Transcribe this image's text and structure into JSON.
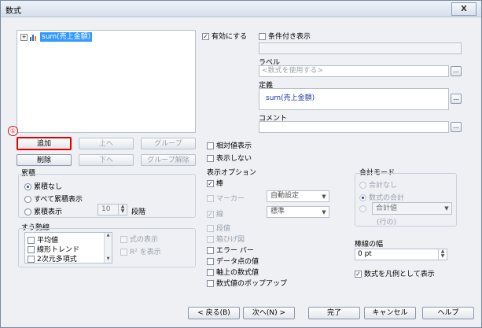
{
  "title": "数式",
  "close_label": "X",
  "tree": {
    "expander": "+",
    "item_label": "sum(売上金額)"
  },
  "badge": "①",
  "buttons": {
    "add": "追加",
    "up": "上へ",
    "group": "グループ",
    "delete": "削除",
    "down": "下へ",
    "ungroup": "グループ解除"
  },
  "enable": {
    "label": "有効にする",
    "checked": true
  },
  "conditional": {
    "label": "条件付き表示",
    "checked": false
  },
  "label_section": {
    "title": "ラベル",
    "placeholder": "<数式を使用する>"
  },
  "definition": {
    "title": "定義",
    "value": "sum(売上金額)"
  },
  "comment": {
    "title": "コメント",
    "value": ""
  },
  "ellipsis": "...",
  "relative": {
    "label": "相対値表示",
    "checked": false
  },
  "hidden": {
    "label": "表示しない",
    "checked": false
  },
  "accumulation": {
    "title": "累積",
    "options": [
      "累積なし",
      "すべて累積表示",
      "累積表示"
    ],
    "selected": 0,
    "steps_value": "10",
    "steps_label": "段階"
  },
  "trendline": {
    "title": "すう勢線",
    "items": [
      "平均値",
      "線形トレンド",
      "2次元多項式"
    ],
    "show_formula": "式の表示",
    "show_r2": "R² を表示"
  },
  "display_options": {
    "title": "表示オプション",
    "bar": {
      "label": "棒",
      "checked": true
    },
    "marker": {
      "label": "マーカー",
      "value": "自動設定"
    },
    "line": {
      "label": "線",
      "value": "標準"
    },
    "step": "段値",
    "box": "箱ひげ図",
    "error_bar": "エラー バー",
    "data_values": "データ点の値",
    "axis_values": "軸上の数式値",
    "popup": "数式値のポップアップ"
  },
  "total_mode": {
    "title": "合計モード",
    "options": [
      "合計なし",
      "数式の合計"
    ],
    "total_value": "合計値",
    "row_label": "(行の)"
  },
  "bar_width": {
    "title": "棒線の幅",
    "value": "0 pt"
  },
  "legend": {
    "label": "数式を凡例として表示",
    "checked": true
  },
  "footer": {
    "back": "< 戻る(B)",
    "next": "次へ(N) >",
    "finish": "完了",
    "cancel": "キャンセル",
    "help": "ヘルプ"
  },
  "colors": {
    "accent_red": "#e00000",
    "select_blue": "#3399ff"
  }
}
